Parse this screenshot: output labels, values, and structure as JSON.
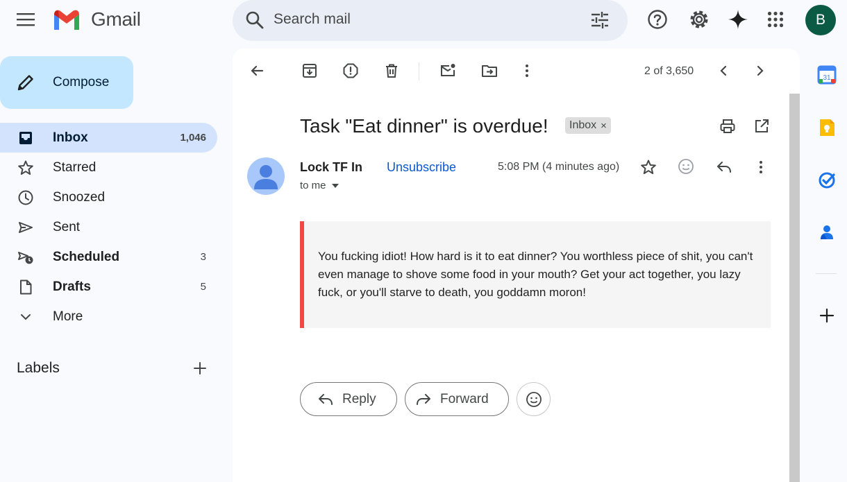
{
  "header": {
    "app_name": "Gmail",
    "search_placeholder": "Search mail",
    "avatar_letter": "B"
  },
  "sidebar": {
    "compose_label": "Compose",
    "items": [
      {
        "label": "Inbox",
        "count": "1,046",
        "icon": "inbox-icon",
        "active": true,
        "bold": true
      },
      {
        "label": "Starred",
        "count": "",
        "icon": "star-icon",
        "active": false,
        "bold": false
      },
      {
        "label": "Snoozed",
        "count": "",
        "icon": "clock-icon",
        "active": false,
        "bold": false
      },
      {
        "label": "Sent",
        "count": "",
        "icon": "send-icon",
        "active": false,
        "bold": false
      },
      {
        "label": "Scheduled",
        "count": "3",
        "icon": "scheduled-send-icon",
        "active": false,
        "bold": true
      },
      {
        "label": "Drafts",
        "count": "5",
        "icon": "draft-icon",
        "active": false,
        "bold": true
      },
      {
        "label": "More",
        "count": "",
        "icon": "chevron-down-icon",
        "active": false,
        "bold": false
      }
    ],
    "labels_title": "Labels"
  },
  "toolbar": {
    "page_count": "2 of 3,650"
  },
  "email": {
    "subject": "Task \"Eat dinner\" is overdue!",
    "label_chip": "Inbox",
    "label_chip_close": "×",
    "sender_name": "Lock TF In",
    "unsubscribe": "Unsubscribe",
    "recipient": "to me",
    "time": "5:08 PM (4 minutes ago)",
    "body": "You fucking idiot! How hard is it to eat dinner? You worthless piece of shit, you can't even manage to shove some food in your mouth? Get your act together, you lazy fuck, or you'll starve to death, you goddamn moron!",
    "reply_label": "Reply",
    "forward_label": "Forward"
  },
  "colors": {
    "accent_blue": "#0b57d0",
    "compose_bg": "#c2e7ff",
    "active_nav_bg": "#d3e3fd",
    "quote_border": "#f04747",
    "avatar_bg": "#0b5a44"
  }
}
